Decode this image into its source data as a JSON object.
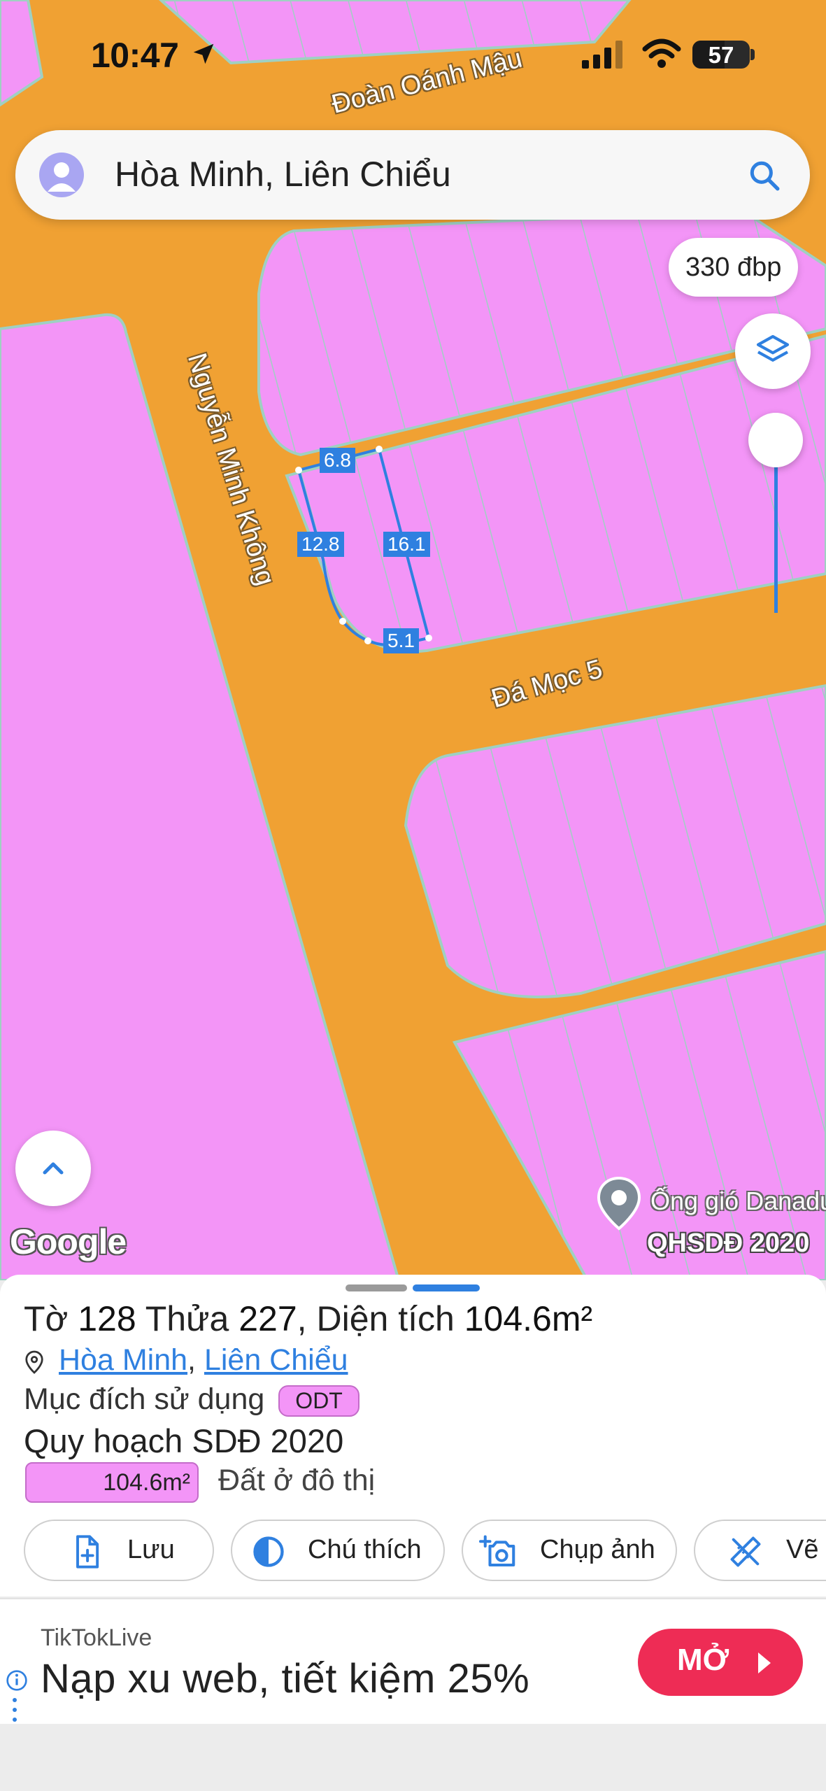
{
  "status_bar": {
    "time": "10:47",
    "battery": "57"
  },
  "search": {
    "query": "Hòa Minh, Liên Chiểu"
  },
  "map": {
    "scale_chip": "330 đbp",
    "road_labels": {
      "top": "Đoàn Oánh Mậu",
      "left": "Nguyễn Minh Không",
      "right": "Đá Mọc 5"
    },
    "dimensions": {
      "top_edge": "6.8",
      "left_edge": "12.8",
      "right_edge": "16.1",
      "bottom_edge": "5.1"
    },
    "attribution": "Google",
    "poi_label": "Ống gió Danadu",
    "source_label": "QHSDĐ 2020",
    "colors": {
      "road": "#f0a133",
      "residential": "#f395f7",
      "parcel_outline": "#2f80e0"
    }
  },
  "parcel": {
    "sheet_label": "Tờ",
    "sheet_no": "128",
    "plot_label": "Thửa",
    "plot_no": "227",
    "area_label": "Diện tích",
    "area": "104.6m²",
    "ward": "Hòa Minh",
    "district": "Liên Chiểu",
    "purpose_label": "Mục đích sử dụng",
    "purpose_code": "ODT",
    "plan_label": "Quy hoạch SDĐ 2020",
    "plan_area": "104.6m²",
    "plan_type": "Đất ở đô thị"
  },
  "actions": {
    "save": "Lưu",
    "legend": "Chú thích",
    "capture": "Chụp ảnh",
    "draw": "Vẽ"
  },
  "ad": {
    "brand": "TikTokLive",
    "text": "Nạp xu web, tiết kiệm 25%",
    "cta": "MỞ"
  }
}
